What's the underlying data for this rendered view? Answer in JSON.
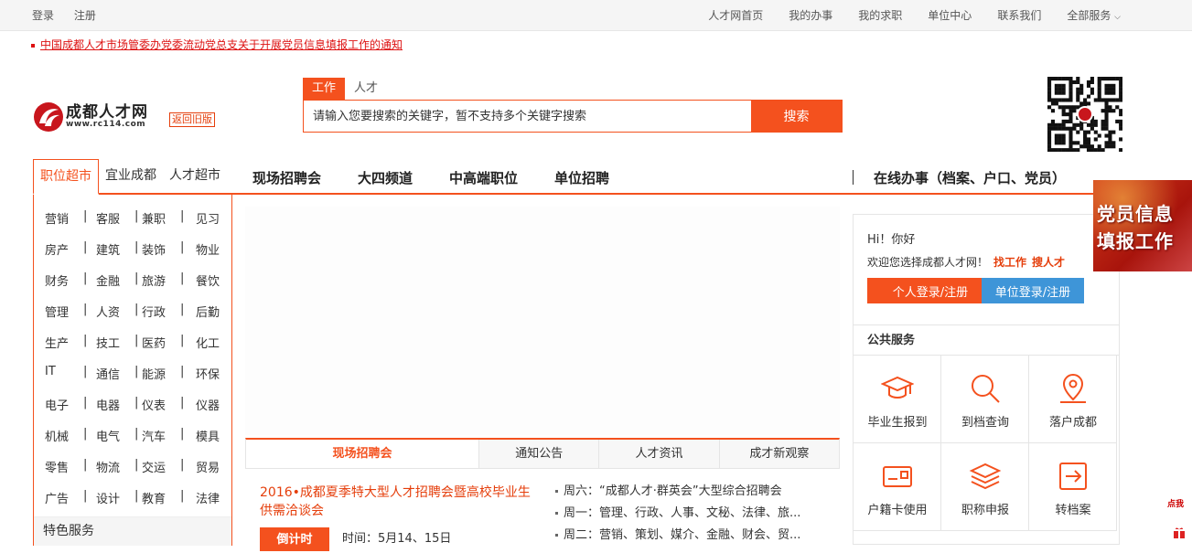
{
  "topbar": {
    "login": "登录",
    "register": "注册",
    "links": [
      "人才网首页",
      "我的办事",
      "我的求职",
      "单位中心",
      "联系我们",
      "全部服务"
    ]
  },
  "notice": "中国成都人才市场管委办党委流动党总支关于开展党员信息填报工作的通知",
  "logo": {
    "name": "成都人才网",
    "url": "www.rc114.com",
    "old_version": "返回旧版"
  },
  "search": {
    "tabs": [
      "工作",
      "人才"
    ],
    "placeholder": "请输入您要搜索的关键字，暂不支持多个关键字搜索",
    "button": "搜索"
  },
  "category_tabs": [
    "职位超市",
    "宜业成都",
    "人才超市"
  ],
  "main_nav": [
    "现场招聘会",
    "大四频道",
    "中高端职位",
    "单位招聘"
  ],
  "online_service": "在线办事（档案、户口、党员）",
  "categories": [
    [
      "营销",
      "客服",
      "兼职",
      "见习"
    ],
    [
      "房产",
      "建筑",
      "装饰",
      "物业"
    ],
    [
      "财务",
      "金融",
      "旅游",
      "餐饮"
    ],
    [
      "管理",
      "人资",
      "行政",
      "后勤"
    ],
    [
      "生产",
      "技工",
      "医药",
      "化工"
    ],
    [
      "IT",
      "通信",
      "能源",
      "环保"
    ],
    [
      "电子",
      "电器",
      "仪表",
      "仪器"
    ],
    [
      "机械",
      "电气",
      "汽车",
      "模具"
    ],
    [
      "零售",
      "物流",
      "交运",
      "贸易"
    ],
    [
      "广告",
      "设计",
      "教育",
      "法律"
    ]
  ],
  "featured_services": "特色服务",
  "news_tabs": [
    "现场招聘会",
    "通知公告",
    "人才资讯",
    "成才新观察"
  ],
  "fair": {
    "title": "2016•成都夏季特大型人才招聘会暨高校毕业生供需洽谈会",
    "countdown": "倒计时",
    "time": "时间：5月14、15日"
  },
  "week_list": [
    "周六：“成都人才·群英会”大型综合招聘会",
    "周一：管理、行政、人事、文秘、法律、旅...",
    "周二：营销、策划、媒介、金融、财会、贸..."
  ],
  "user": {
    "hi": "Hi！你好",
    "welcome": "欢迎您选择成都人才网！",
    "find_job": "找工作",
    "find_talent": "搜人才",
    "personal_btn": "个人登录/注册",
    "company_btn": "单位登录/注册"
  },
  "public_services": {
    "title": "公共服务",
    "items": [
      {
        "label": "毕业生报到",
        "icon": "graduation-cap-icon"
      },
      {
        "label": "到档查询",
        "icon": "magnifier-icon"
      },
      {
        "label": "落户成都",
        "icon": "location-pin-icon"
      },
      {
        "label": "户籍卡使用",
        "icon": "id-card-icon"
      },
      {
        "label": "职称申报",
        "icon": "layers-icon"
      },
      {
        "label": "转档案",
        "icon": "transfer-icon"
      }
    ]
  },
  "party_ad": [
    "党员信息",
    "填报工作"
  ],
  "side_tag": "点我",
  "colors": {
    "accent": "#f4511e",
    "blue": "#3e95d8",
    "link_red": "#e53e0b"
  }
}
